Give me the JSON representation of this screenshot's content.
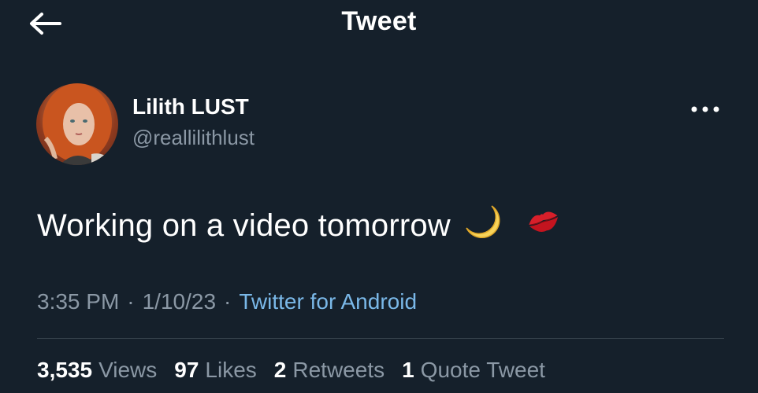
{
  "header": {
    "title": "Tweet",
    "back_icon": "arrow-left-icon"
  },
  "author": {
    "display_name": "Lilith LUST",
    "handle": "@reallilithlust"
  },
  "tweet": {
    "text": "Working on a video tomorrow",
    "emojis": [
      "🌙",
      "💋"
    ],
    "time": "3:35 PM",
    "date": "1/10/23",
    "source": "Twitter for Android"
  },
  "stats": {
    "views_count": "3,535",
    "views_label": "Views",
    "likes_count": "97",
    "likes_label": "Likes",
    "retweets_count": "2",
    "retweets_label": "Retweets",
    "quotes_count": "1",
    "quotes_label": "Quote Tweet"
  },
  "colors": {
    "background": "#15202b",
    "secondary_text": "#8b98a5",
    "link": "#7ab8e8",
    "divider": "#38444d"
  }
}
